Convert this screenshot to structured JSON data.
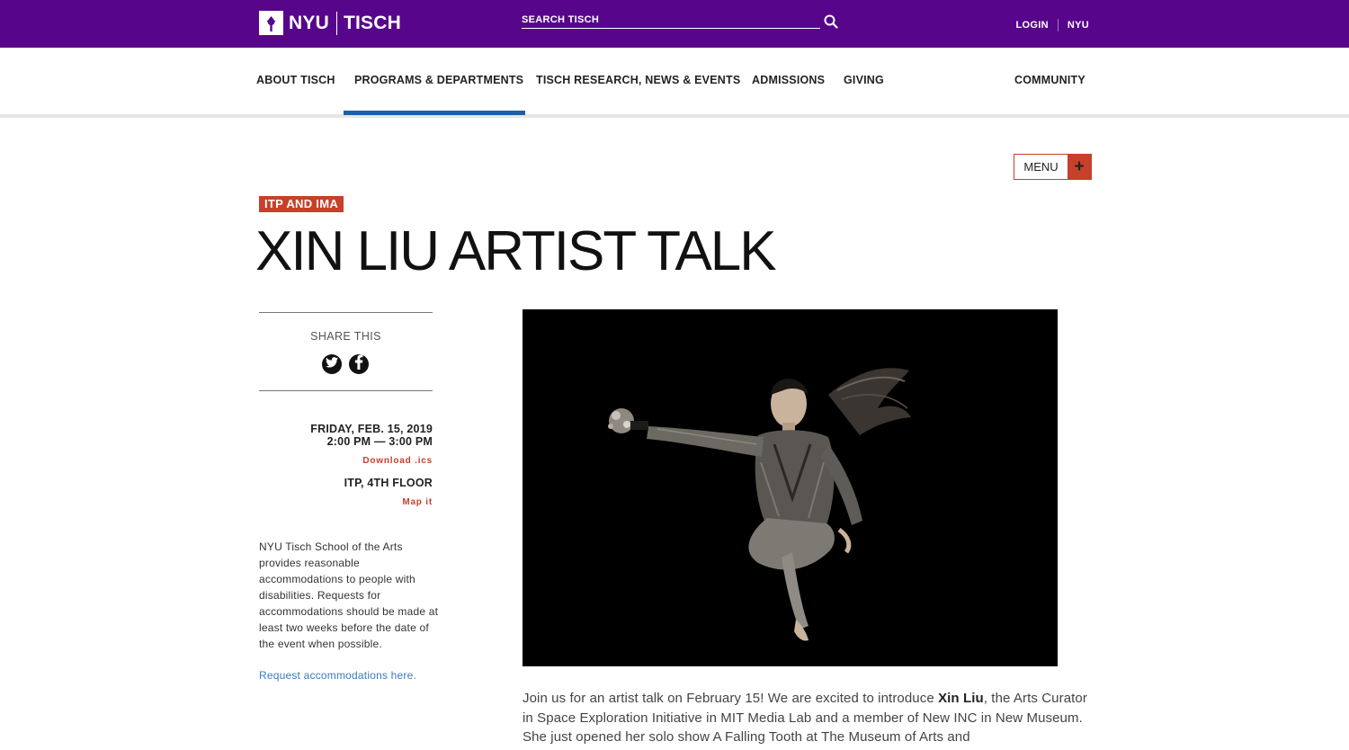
{
  "topbar": {
    "logo_left": "NYU",
    "logo_right": "TISCH",
    "search_placeholder": "SEARCH TISCH",
    "login_label": "LOGIN",
    "nyu_label": "NYU",
    "background_color": "#57068c"
  },
  "nav": {
    "items": [
      {
        "label": "ABOUT TISCH"
      },
      {
        "label": "PROGRAMS & DEPARTMENTS",
        "active": true
      },
      {
        "label": "TISCH RESEARCH, NEWS & EVENTS"
      },
      {
        "label": "ADMISSIONS"
      },
      {
        "label": "GIVING"
      },
      {
        "label": "COMMUNITY"
      }
    ],
    "active_color": "#1d5fa9"
  },
  "menu": {
    "label": "MENU",
    "icon": "plus-icon"
  },
  "event": {
    "category": "ITP AND IMA",
    "title": "XIN LIU ARTIST TALK",
    "accent_color": "#c7402a"
  },
  "sidebar": {
    "share_label": "SHARE THIS",
    "share_icons": [
      "twitter-icon",
      "facebook-icon"
    ],
    "date": "FRIDAY, FEB. 15, 2019",
    "time": "2:00 PM — 3:00 PM",
    "download_label": "Download .ics",
    "location": "ITP, 4TH FLOOR",
    "map_label": "Map it",
    "accessibility_text": "NYU Tisch School of the Arts provides reasonable accommodations to people with disabilities. Requests for accommodations should be made at least two weeks before the date of the event when possible.",
    "accessibility_link": "Request accommodations here."
  },
  "body": {
    "intro": "Join us for an artist talk on February 15! We are excited to introduce ",
    "name": "Xin Liu",
    "rest": ", the Arts Curator in Space Exploration Initiative in MIT Media Lab and a member of New INC in New Museum. She just opened her solo show A Falling Tooth at The Museum of Arts and"
  }
}
